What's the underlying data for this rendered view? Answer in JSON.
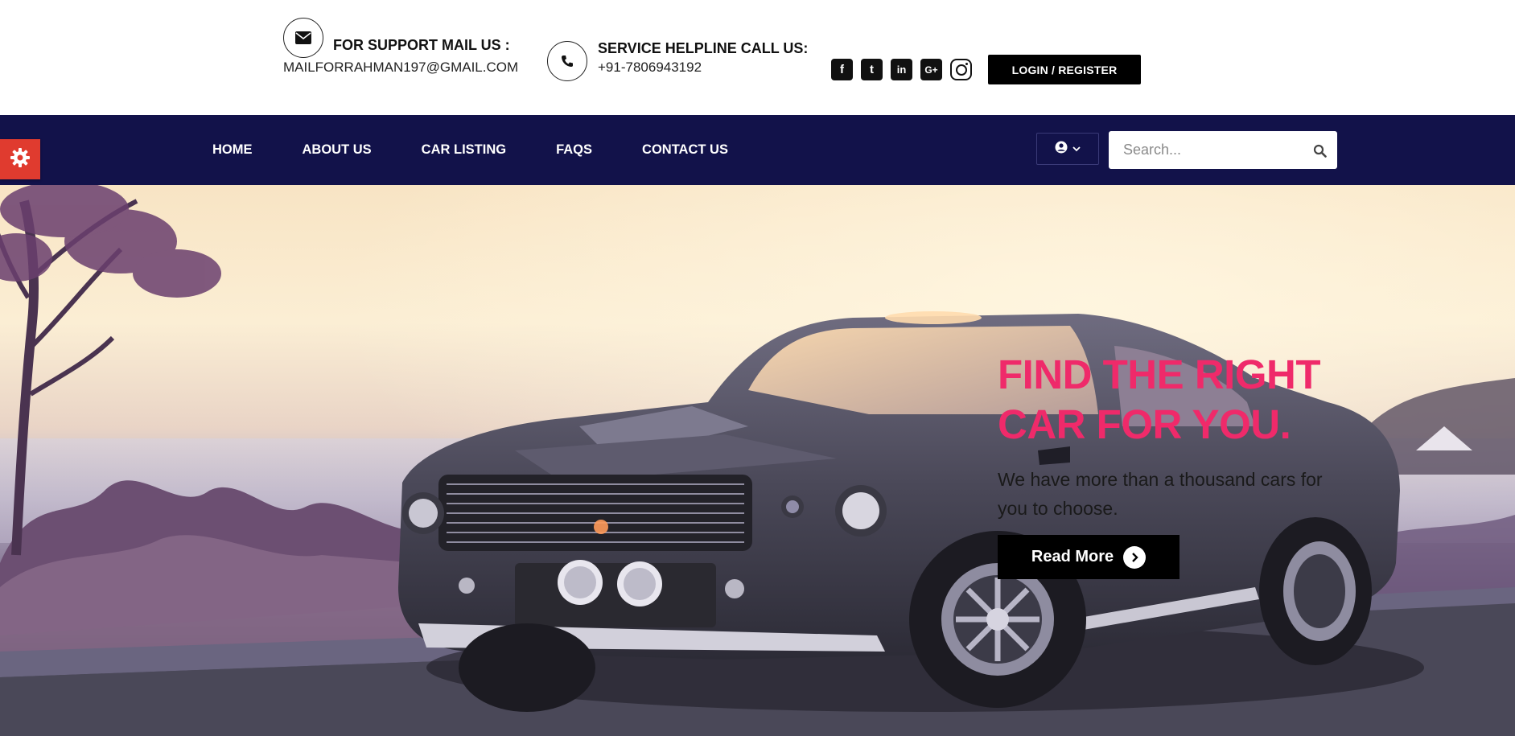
{
  "header": {
    "support_title": "FOR SUPPORT MAIL US :",
    "support_email": "MAILFORRAHMAN197@GMAIL.COM",
    "helpline_title": "SERVICE HELPLINE CALL US:",
    "helpline_phone": "+91-7806943192",
    "socials": [
      {
        "name": "facebook-icon",
        "glyph": "f"
      },
      {
        "name": "twitter-icon",
        "glyph": "t"
      },
      {
        "name": "linkedin-icon",
        "glyph": "in"
      },
      {
        "name": "google-plus-icon",
        "glyph": "G+"
      },
      {
        "name": "instagram-icon",
        "glyph": ""
      }
    ],
    "login_label": "LOGIN / REGISTER"
  },
  "nav": {
    "items": [
      {
        "label": "HOME"
      },
      {
        "label": "ABOUT US"
      },
      {
        "label": "CAR LISTING"
      },
      {
        "label": "FAQS"
      },
      {
        "label": "CONTACT US"
      }
    ],
    "search_placeholder": "Search..."
  },
  "hero": {
    "title": "FIND THE RIGHT CAR FOR YOU.",
    "subtitle": "We have more than a thousand cars for you to choose.",
    "button_label": "Read More"
  },
  "colors": {
    "nav_bg": "#12124a",
    "accent": "#ef2a6a",
    "settings_tab": "#e03b2f"
  }
}
